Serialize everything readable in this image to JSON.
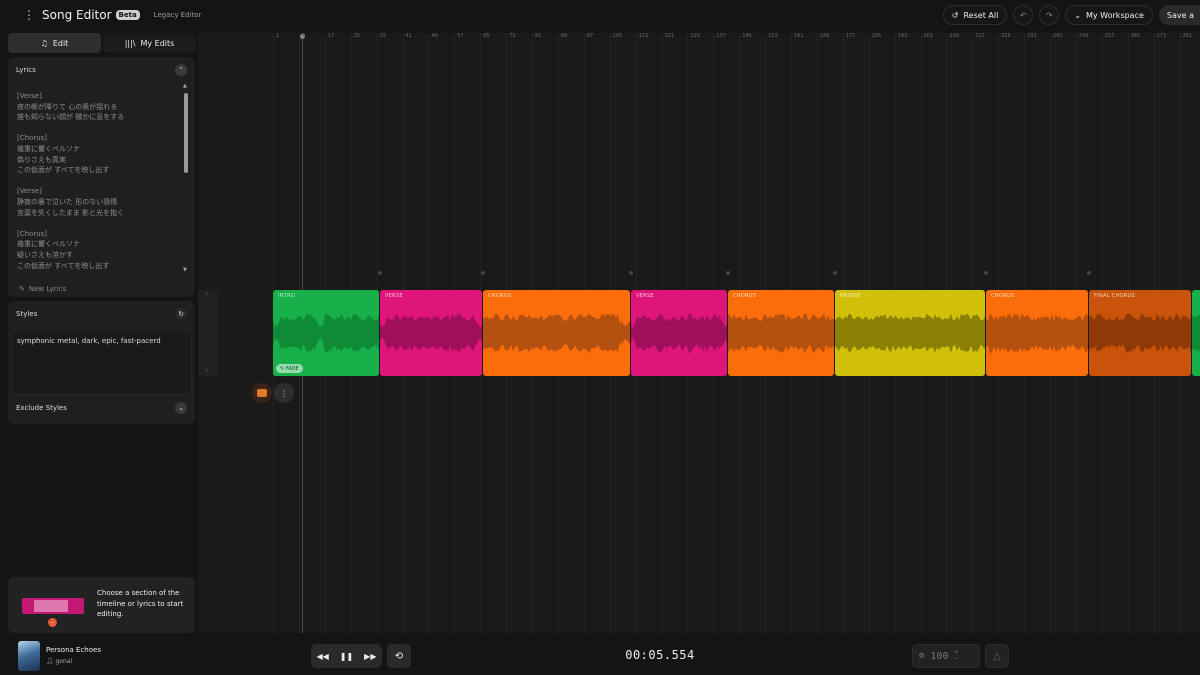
{
  "header": {
    "app_title": "Song Editor",
    "badge": "Beta",
    "legacy_link": "Legacy Editor",
    "reset_label": "Reset All",
    "workspace_label": "My Workspace",
    "save_label": "Save a"
  },
  "sidebar": {
    "tabs": [
      {
        "label": "Edit",
        "icon": "music-note-icon",
        "active": true
      },
      {
        "label": "My Edits",
        "icon": "library-icon",
        "active": false
      }
    ],
    "lyrics": {
      "heading": "Lyrics",
      "lines": [
        "[Verse]",
        "夜の帳が降りて 心の奥が揺れる",
        "誰も知らない顔が 微かに息をする",
        "",
        "[Chorus]",
        "幾重に響くペルソナ",
        "偽りさえも真実",
        "この仮面が すべてを映し出す",
        "",
        "[Verse]",
        "静寂の裏で泣いた 形のない感情",
        "言葉を失くしたまま 影と光を抱く",
        "",
        "[Chorus]",
        "幾重に響くペルソナ",
        "疑いさえも溶かす",
        "この仮面が すべてを映し出す"
      ],
      "new_lyrics_label": "New Lyrics"
    },
    "styles": {
      "heading": "Styles",
      "value": "symphonic metal, dark, epic, fast-pacerd"
    },
    "exclude_styles": {
      "heading": "Exclude Styles"
    },
    "tip": {
      "text": "Choose a section of the timeline or lyrics to start editing."
    }
  },
  "timeline": {
    "ruler": [
      "1",
      "9",
      "17",
      "25",
      "33",
      "41",
      "49",
      "57",
      "65",
      "73",
      "81",
      "89",
      "97",
      "105",
      "113",
      "121",
      "129",
      "137",
      "145",
      "153",
      "161",
      "169",
      "177",
      "185",
      "193",
      "201",
      "209",
      "217",
      "225",
      "233",
      "241",
      "249",
      "257",
      "265",
      "273",
      "281"
    ],
    "segments": [
      {
        "label": "INTRO",
        "color": "#17b04b",
        "wave": "#0f8a37",
        "fade_label": "FADE"
      },
      {
        "label": "VERSE",
        "color": "#e0157c",
        "wave": "#a0105a"
      },
      {
        "label": "CHORUS",
        "color": "#fb6d0a",
        "wave": "#b45010"
      },
      {
        "label": "VERSE",
        "color": "#e0157c",
        "wave": "#a0105a"
      },
      {
        "label": "CHORUS",
        "color": "#fb6d0a",
        "wave": "#b45010"
      },
      {
        "label": "BRIDGE",
        "color": "#d1c00a",
        "wave": "#8c7f06"
      },
      {
        "label": "CHORUS",
        "color": "#fb6d0a",
        "wave": "#b45010"
      },
      {
        "label": "FINAL CHORUS",
        "color": "#c9530a",
        "wave": "#8f3a06"
      },
      {
        "label": "",
        "color": "#17b04b",
        "wave": "#0f8a37"
      }
    ]
  },
  "player": {
    "song_title": "Persona Echoes",
    "user": "gonal",
    "time": "00:05.554",
    "bpm": "100"
  }
}
